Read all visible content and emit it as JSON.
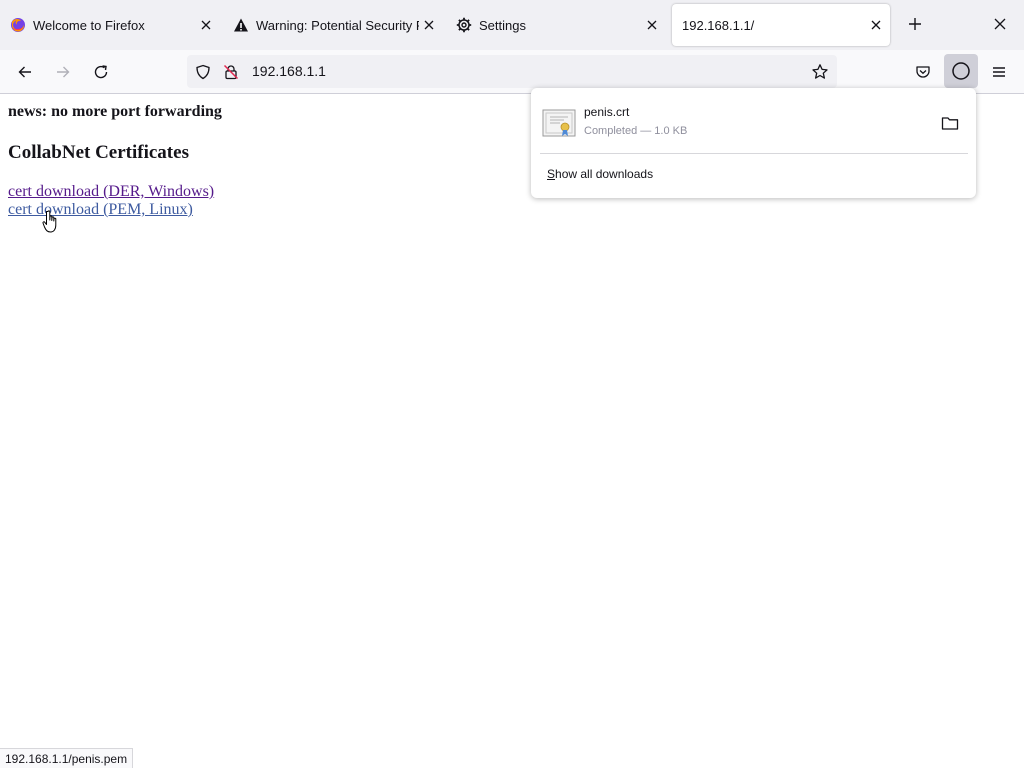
{
  "tabs": [
    {
      "title": "Welcome to Firefox",
      "icon": "firefox-icon",
      "active": false
    },
    {
      "title": "Warning: Potential Security Risk",
      "icon": "warning-icon",
      "active": false
    },
    {
      "title": "Settings",
      "icon": "gear-icon",
      "active": false
    },
    {
      "title": "192.168.1.1/",
      "icon": "",
      "active": true
    }
  ],
  "toolbar": {
    "url": "192.168.1.1"
  },
  "page": {
    "news": "news: no more port forwarding",
    "heading": "CollabNet Certificates",
    "links": [
      {
        "label": "cert download (DER, Windows)",
        "state": "visited"
      },
      {
        "label": "cert download (PEM, Linux)",
        "state": "hover"
      }
    ]
  },
  "downloads": {
    "items": [
      {
        "name": "penis.crt",
        "status": "Completed — 1.0 KB",
        "icon": "certificate-file-icon"
      }
    ],
    "show_all_label": "Show all downloads"
  },
  "status_bar": {
    "text": "192.168.1.1/penis.pem"
  },
  "colors": {
    "tabbar_bg": "#f0f0f4",
    "toolbar_bg": "#f9f9fb",
    "active_tab": "#ffffff",
    "visited_link": "#551a8b",
    "link": "#0000ee"
  }
}
